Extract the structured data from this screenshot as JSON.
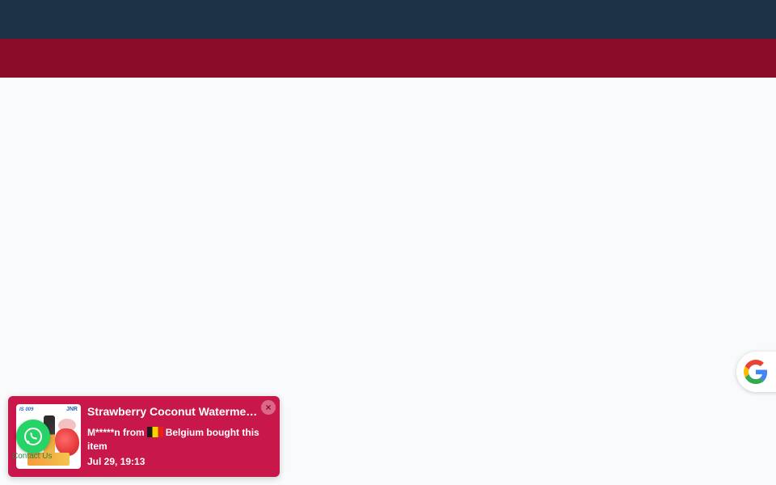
{
  "sales_popup": {
    "product_title": "Strawberry Coconut Waterme…",
    "buyer_name": "M*****n",
    "from_word": "from",
    "country": "Belgium",
    "action_text": "bought this item",
    "timestamp": "Jul 29, 19:13",
    "close_icon": "×",
    "thumbnail_brand_left": "IS 009",
    "thumbnail_brand_right": "JNR"
  },
  "whatsapp": {
    "label": "Contact Us",
    "icon": "whatsapp-icon",
    "color": "#25d366"
  },
  "google_badge": {
    "icon": "google-g-icon"
  },
  "colors": {
    "topbar": "#1c3046",
    "navbar": "#8b0c27",
    "popup": "#c8174a"
  }
}
